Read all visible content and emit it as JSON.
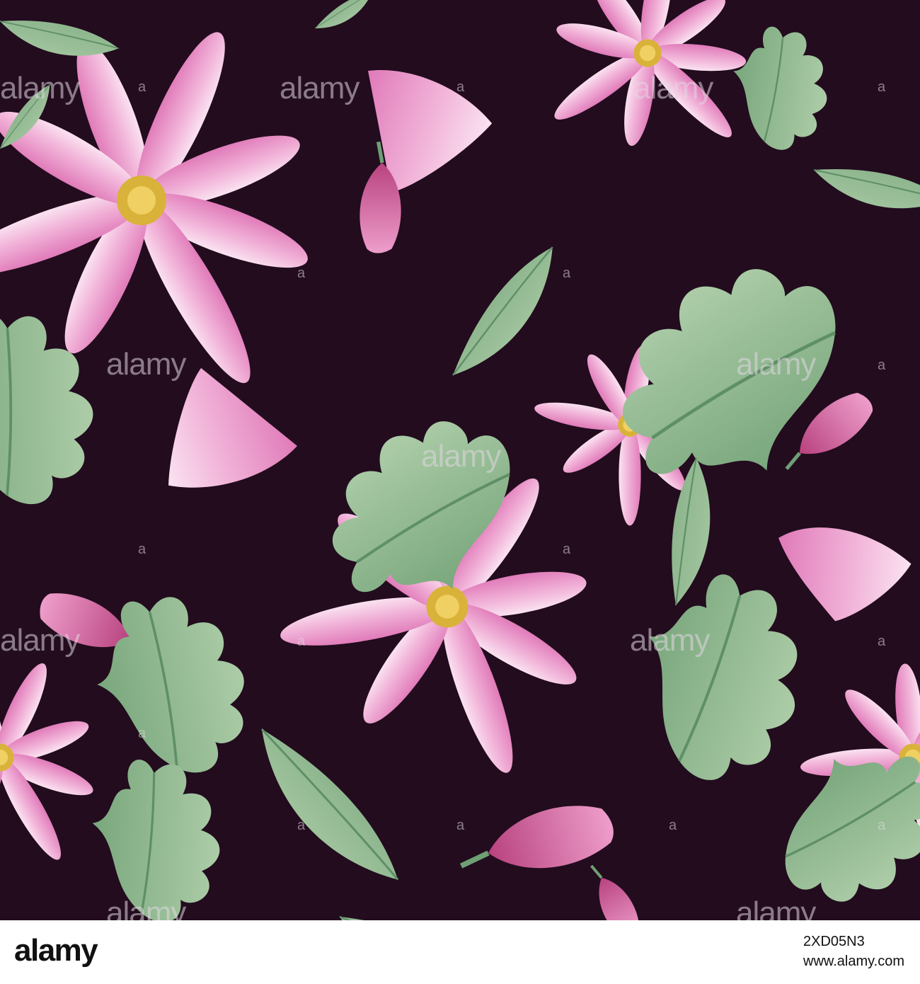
{
  "watermark": {
    "text": "alamy",
    "dot": "a"
  },
  "footer": {
    "logo": "alamy",
    "image_id": "2XD05N3",
    "site": "www.alamy.com"
  },
  "colors": {
    "background": "#220c1e",
    "petal_pink": "#e98cc4",
    "petal_light": "#f6cde6",
    "center_yellow": "#d9b23a",
    "leaf_green": "#8fb88e"
  }
}
